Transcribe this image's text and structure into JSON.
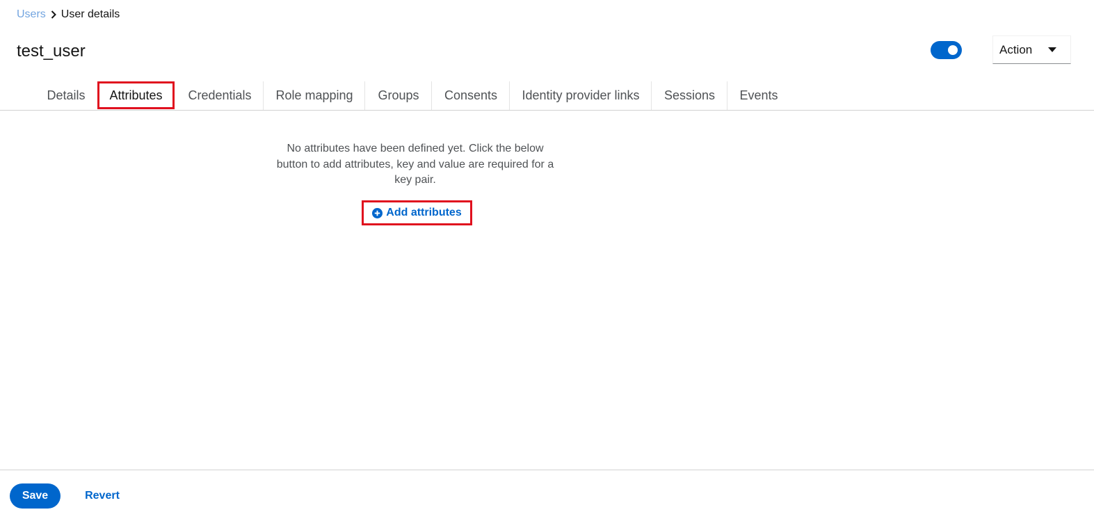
{
  "breadcrumb": {
    "parent": "Users",
    "current": "User details"
  },
  "header": {
    "title": "test_user",
    "enabled": true,
    "action_label": "Action"
  },
  "tabs": [
    {
      "label": "Details"
    },
    {
      "label": "Attributes",
      "active": true
    },
    {
      "label": "Credentials"
    },
    {
      "label": "Role mapping"
    },
    {
      "label": "Groups"
    },
    {
      "label": "Consents"
    },
    {
      "label": "Identity provider links"
    },
    {
      "label": "Sessions"
    },
    {
      "label": "Events"
    }
  ],
  "empty_state": {
    "message": "No attributes have been defined yet. Click the below button to add attributes, key and value are required for a key pair.",
    "button_label": "Add attributes",
    "button_icon": "plus-circle-icon"
  },
  "footer": {
    "save_label": "Save",
    "revert_label": "Revert"
  },
  "colors": {
    "primary": "#0066cc",
    "highlight": "#e0101e",
    "breadcrumb_link": "#73a5e0"
  }
}
